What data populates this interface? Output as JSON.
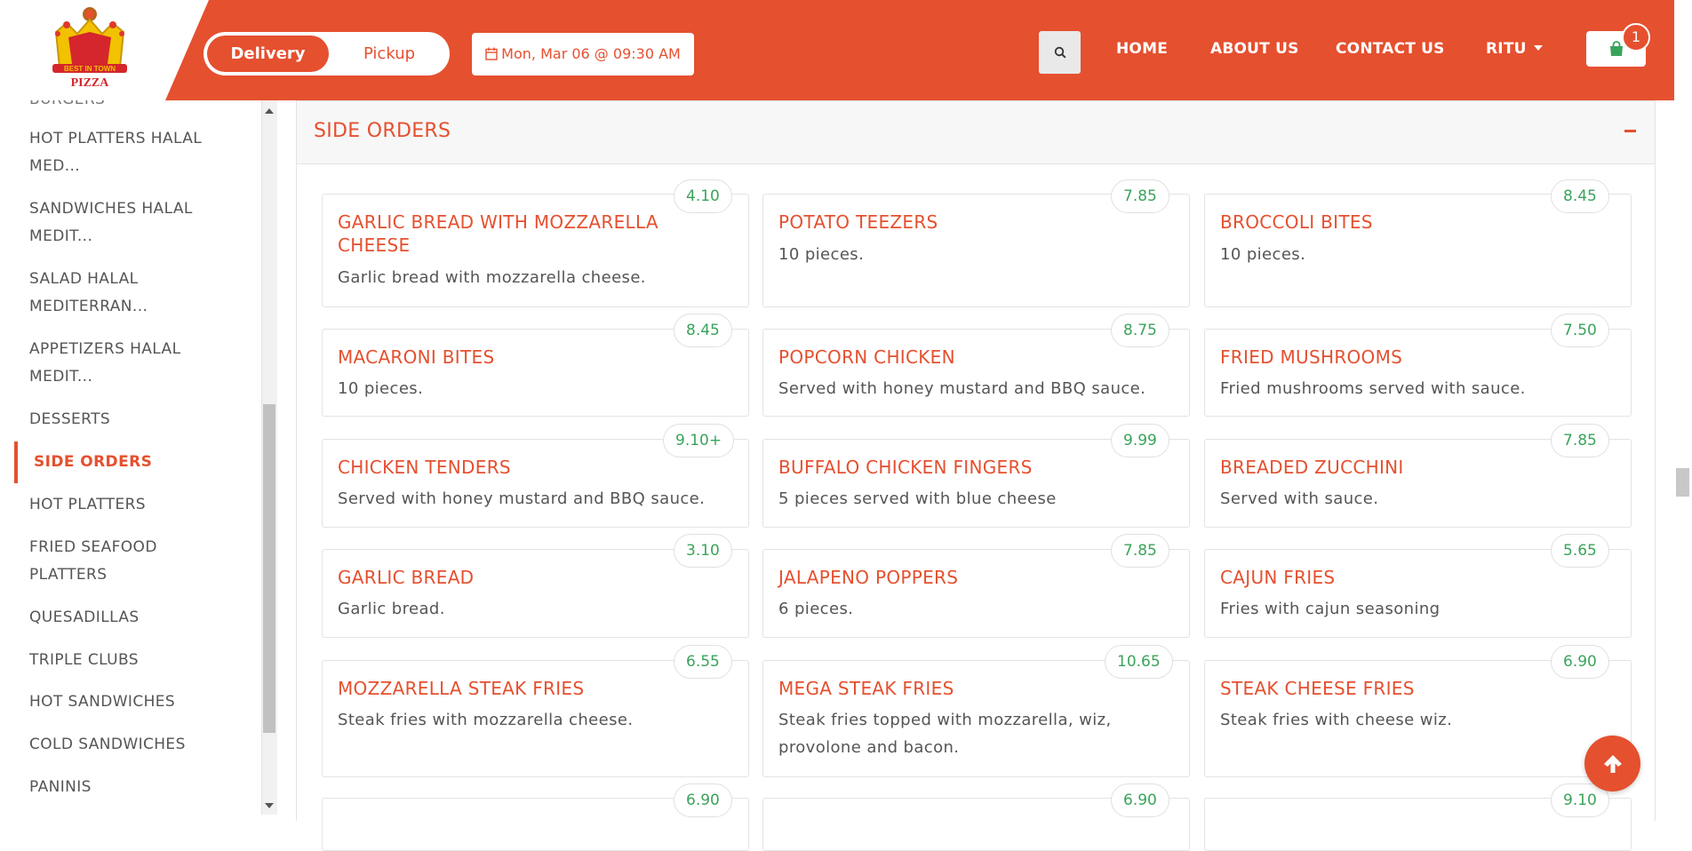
{
  "header": {
    "logo_text": "BEST IN TOWN PIZZA",
    "order_mode": {
      "delivery": "Delivery",
      "pickup": "Pickup",
      "selected": "Delivery"
    },
    "date_label": "Mon, Mar 06 @ 09:30 AM",
    "nav": {
      "home": "HOME",
      "about": "ABOUT US",
      "contact": "CONTACT US",
      "user": "RITU"
    },
    "cart_count": "1"
  },
  "sidebar": {
    "partial_top": "BURGERS",
    "items": [
      {
        "label": "HOT PLATTERS HALAL MED..."
      },
      {
        "label": "SANDWICHES HALAL MEDIT..."
      },
      {
        "label": "SALAD HALAL MEDITERRAN..."
      },
      {
        "label": "APPETIZERS HALAL MEDIT..."
      },
      {
        "label": "DESSERTS"
      },
      {
        "label": "SIDE ORDERS"
      },
      {
        "label": "HOT PLATTERS"
      },
      {
        "label": "FRIED SEAFOOD PLATTERS"
      },
      {
        "label": "QUESADILLAS"
      },
      {
        "label": "TRIPLE CLUBS"
      },
      {
        "label": "HOT SANDWICHES"
      },
      {
        "label": "COLD SANDWICHES"
      },
      {
        "label": "PANINIS"
      }
    ],
    "active": "SIDE ORDERS"
  },
  "section": {
    "title": "SIDE ORDERS",
    "items": [
      {
        "name": "GARLIC BREAD WITH MOZZARELLA CHEESE",
        "desc": "Garlic bread with mozzarella cheese.",
        "price": "4.10"
      },
      {
        "name": "POTATO TEEZERS",
        "desc": "10 pieces.",
        "price": "7.85"
      },
      {
        "name": "BROCCOLI BITES",
        "desc": "10 pieces.",
        "price": "8.45"
      },
      {
        "name": "MACARONI BITES",
        "desc": "10 pieces.",
        "price": "8.45"
      },
      {
        "name": "POPCORN CHICKEN",
        "desc": "Served with honey mustard and BBQ sauce.",
        "price": "8.75"
      },
      {
        "name": "FRIED MUSHROOMS",
        "desc": "Fried mushrooms served with sauce.",
        "price": "7.50"
      },
      {
        "name": "CHICKEN TENDERS",
        "desc": "Served with honey mustard and BBQ sauce.",
        "price": "9.10+"
      },
      {
        "name": "BUFFALO CHICKEN FINGERS",
        "desc": "5 pieces served with blue cheese",
        "price": "9.99"
      },
      {
        "name": "BREADED ZUCCHINI",
        "desc": "Served with sauce.",
        "price": "7.85"
      },
      {
        "name": "GARLIC BREAD",
        "desc": "Garlic bread.",
        "price": "3.10"
      },
      {
        "name": "JALAPENO POPPERS",
        "desc": "6 pieces.",
        "price": "7.85"
      },
      {
        "name": "CAJUN FRIES",
        "desc": "Fries with cajun seasoning",
        "price": "5.65"
      },
      {
        "name": "MOZZARELLA STEAK FRIES",
        "desc": "Steak fries with mozzarella cheese.",
        "price": "6.55"
      },
      {
        "name": "MEGA STEAK FRIES",
        "desc": "Steak fries topped with mozzarella, wiz, provolone and bacon.",
        "price": "10.65"
      },
      {
        "name": "STEAK CHEESE FRIES",
        "desc": "Steak fries with cheese wiz.",
        "price": "6.90"
      },
      {
        "name": "",
        "desc": "",
        "price": "6.90"
      },
      {
        "name": "",
        "desc": "",
        "price": "6.90"
      },
      {
        "name": "",
        "desc": "",
        "price": "9.10"
      }
    ]
  },
  "colors": {
    "brand": "#e5502f",
    "price": "#3aa35b"
  },
  "icons": [
    "calendar-icon",
    "search-icon",
    "shopping-bag-icon",
    "arrow-up-icon",
    "minus-icon"
  ]
}
